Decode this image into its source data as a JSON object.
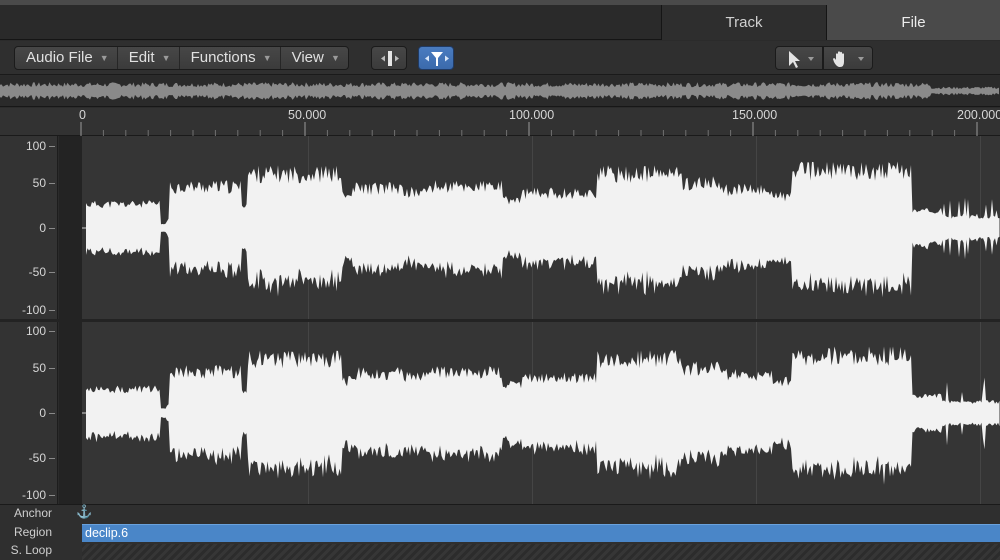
{
  "tabs": [
    {
      "label": "Track"
    },
    {
      "label": "File"
    }
  ],
  "toolbar": {
    "menus": [
      "Audio File",
      "Edit",
      "Functions",
      "View"
    ],
    "tools": {
      "catch": "catch-icon",
      "flex": "flex-icon",
      "pointer": "pointer-tool-icon",
      "hand": "hand-tool-icon"
    }
  },
  "ruler": {
    "labels": [
      "0",
      "50.000",
      "100.000",
      "150.000",
      "200.000"
    ]
  },
  "amplitude": {
    "channel1": [
      "100",
      "50",
      "0",
      "-50",
      "-100"
    ],
    "channel2": [
      "100",
      "50",
      "0",
      "-50",
      "-100"
    ]
  },
  "rows": {
    "anchor": "Anchor",
    "region": "Region",
    "sloop": "S. Loop"
  },
  "region": {
    "name": "declip.6"
  },
  "colors": {
    "region": "#4a86c8",
    "selected_tool": "#4a7cc0",
    "waveform": "#f2f2f2"
  }
}
